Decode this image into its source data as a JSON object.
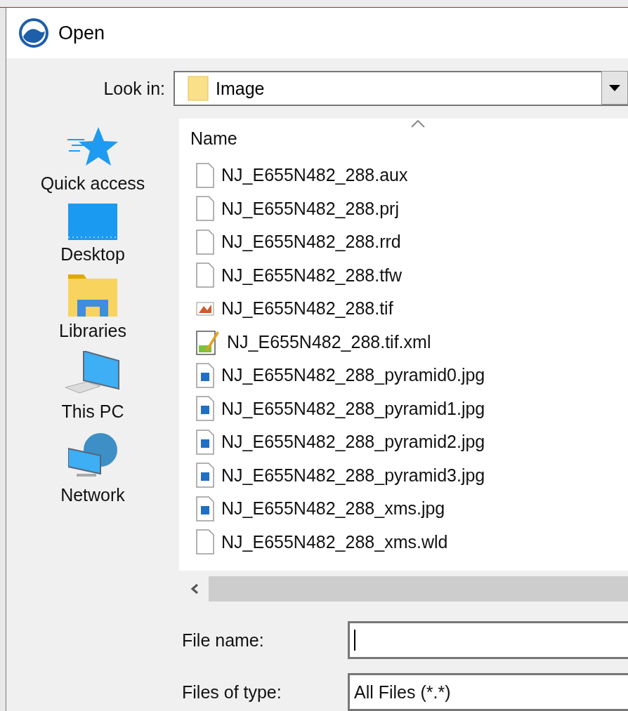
{
  "window": {
    "title": "Open"
  },
  "look_in": {
    "label": "Look in:",
    "value": "Image"
  },
  "places": [
    {
      "kind": "quick",
      "label": "Quick access"
    },
    {
      "kind": "desktop",
      "label": "Desktop"
    },
    {
      "kind": "libraries",
      "label": "Libraries"
    },
    {
      "kind": "pc",
      "label": "This PC"
    },
    {
      "kind": "network",
      "label": "Network"
    }
  ],
  "file_list": {
    "column": "Name",
    "files": [
      {
        "kind": "blank",
        "name": "NJ_E655N482_288.aux"
      },
      {
        "kind": "blank",
        "name": "NJ_E655N482_288.prj"
      },
      {
        "kind": "blank",
        "name": "NJ_E655N482_288.rrd"
      },
      {
        "kind": "blank",
        "name": "NJ_E655N482_288.tfw"
      },
      {
        "kind": "tif",
        "name": "NJ_E655N482_288.tif"
      },
      {
        "kind": "xml",
        "name": "NJ_E655N482_288.tif.xml"
      },
      {
        "kind": "jpg",
        "name": "NJ_E655N482_288_pyramid0.jpg"
      },
      {
        "kind": "jpg",
        "name": "NJ_E655N482_288_pyramid1.jpg"
      },
      {
        "kind": "jpg",
        "name": "NJ_E655N482_288_pyramid2.jpg"
      },
      {
        "kind": "jpg",
        "name": "NJ_E655N482_288_pyramid3.jpg"
      },
      {
        "kind": "jpg",
        "name": "NJ_E655N482_288_xms.jpg"
      },
      {
        "kind": "blank",
        "name": "NJ_E655N482_288_xms.wld"
      }
    ]
  },
  "file_name": {
    "label": "File name:"
  },
  "file_type": {
    "label": "Files of type:",
    "value": "All Files (*.*)"
  }
}
